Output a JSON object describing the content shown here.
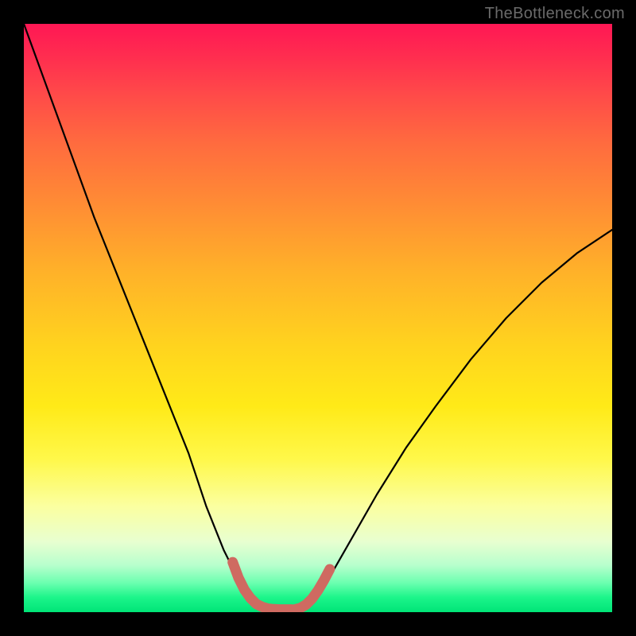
{
  "watermark": {
    "text": "TheBottleneck.com"
  },
  "chart_data": {
    "type": "line",
    "title": "",
    "xlabel": "",
    "ylabel": "",
    "xlim": [
      0,
      100
    ],
    "ylim": [
      0,
      100
    ],
    "grid": false,
    "series": [
      {
        "name": "curve-left",
        "x": [
          0,
          4,
          8,
          12,
          16,
          20,
          24,
          28,
          31,
          34,
          36.5,
          38.5,
          40,
          41
        ],
        "y": [
          100,
          89,
          78,
          67,
          57,
          47,
          37,
          27,
          18,
          10.5,
          5.5,
          2.5,
          1,
          0.5
        ],
        "stroke": "#000000",
        "width": 2.2
      },
      {
        "name": "curve-right",
        "x": [
          47,
          49,
          52,
          56,
          60,
          65,
          70,
          76,
          82,
          88,
          94,
          100
        ],
        "y": [
          0.5,
          2,
          6,
          13,
          20,
          28,
          35,
          43,
          50,
          56,
          61,
          65
        ],
        "stroke": "#000000",
        "width": 2.2
      },
      {
        "name": "highlight-left",
        "x": [
          35.5,
          36.5,
          37.5,
          38.5,
          39.5,
          40.5,
          41.5,
          42.5,
          43.5,
          44.5,
          45.5
        ],
        "y": [
          8.5,
          5.8,
          3.8,
          2.4,
          1.4,
          0.9,
          0.6,
          0.5,
          0.45,
          0.45,
          0.45
        ],
        "stroke": "#cf6a61",
        "width": 13
      },
      {
        "name": "highlight-right",
        "x": [
          46,
          47,
          48,
          49,
          50,
          51,
          52
        ],
        "y": [
          0.45,
          0.7,
          1.3,
          2.3,
          3.7,
          5.4,
          7.3
        ],
        "stroke": "#cf6a61",
        "width": 13
      }
    ],
    "background_gradient": {
      "direction": "vertical",
      "stops": [
        {
          "pos": 0.0,
          "color": "#ff1754"
        },
        {
          "pos": 0.3,
          "color": "#ff8a35"
        },
        {
          "pos": 0.65,
          "color": "#ffea18"
        },
        {
          "pos": 0.88,
          "color": "#e8ffd0"
        },
        {
          "pos": 1.0,
          "color": "#00e477"
        }
      ]
    }
  }
}
